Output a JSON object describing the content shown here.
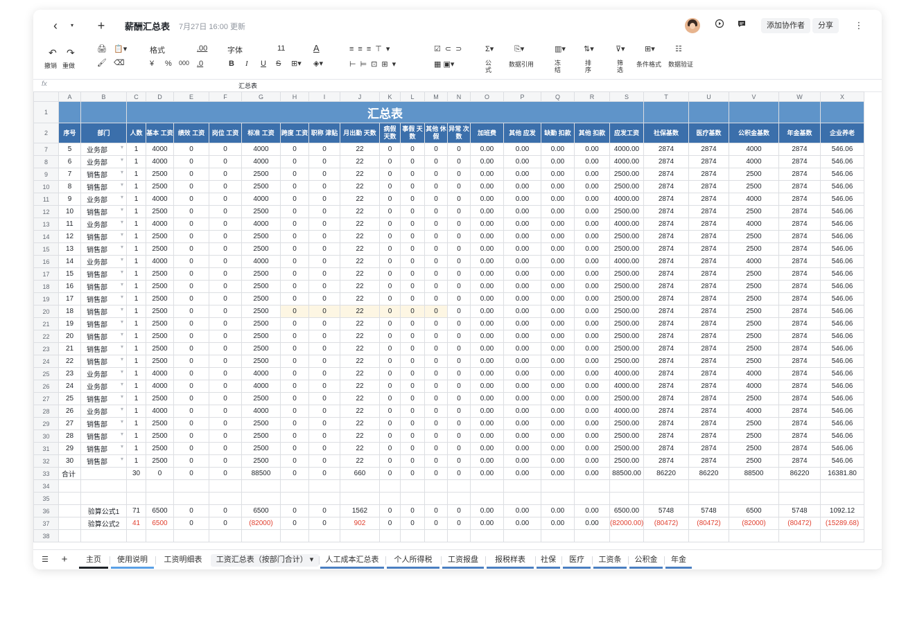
{
  "topbar": {
    "back": "‹",
    "dropdown": "▾",
    "add": "+",
    "title": "薪酬汇总表",
    "updated": "7月27日 16:00 更新",
    "add_collaborator": "添加协作者",
    "share": "分享",
    "more": "⋮"
  },
  "ribbon": {
    "undo": "撤销",
    "redo": "重做",
    "format": "格式",
    "decimal": ".00",
    "font": "字体",
    "font_size": "11",
    "yen": "¥",
    "percent": "%",
    "thousands": "000",
    "decimal2": ".0",
    "bold": "B",
    "italic": "I",
    "underline": "U",
    "strike": "S",
    "formula": "公式",
    "data_ref": "数据引用",
    "freeze": "冻结",
    "sort": "排序",
    "filter": "筛选",
    "cond_format": "条件格式",
    "data_validation": "数据验证"
  },
  "formula_bar": {
    "fx": "fx",
    "value": "汇总表"
  },
  "sheet": {
    "col_letters": [
      "A",
      "B",
      "C",
      "D",
      "E",
      "F",
      "G",
      "H",
      "I",
      "J",
      "K",
      "L",
      "M",
      "N",
      "O",
      "P",
      "Q",
      "R",
      "S",
      "T",
      "U",
      "V",
      "W",
      "X"
    ],
    "title": "汇总表",
    "headers": [
      "序号",
      "部门",
      "人数",
      "基本 工资",
      "绩效 工资",
      "岗位 工资",
      "标准 工资",
      "跨度 工资",
      "职称 津贴",
      "月出勤 天数",
      "病假 天数",
      "事假 天数",
      "其他 休假",
      "异常 次数",
      "加班费",
      "其他 应发",
      "缺勤 扣款",
      "其他 扣款",
      "应发工资",
      "社保基数",
      "医疗基数",
      "公积金基数",
      "年金基数",
      "企业养老"
    ],
    "rows": [
      {
        "r": "7",
        "n": "5",
        "d": "业务部",
        "p": "1",
        "w": "4000",
        "rt": "4000.00",
        "b": "2874",
        "f": "4000",
        "pen": "546.06"
      },
      {
        "r": "8",
        "n": "6",
        "d": "业务部",
        "p": "1",
        "w": "4000",
        "rt": "4000.00",
        "b": "2874",
        "f": "4000",
        "pen": "546.06"
      },
      {
        "r": "9",
        "n": "7",
        "d": "销售部",
        "p": "1",
        "w": "2500",
        "rt": "2500.00",
        "b": "2874",
        "f": "2500",
        "pen": "546.06"
      },
      {
        "r": "10",
        "n": "8",
        "d": "销售部",
        "p": "1",
        "w": "2500",
        "rt": "2500.00",
        "b": "2874",
        "f": "2500",
        "pen": "546.06"
      },
      {
        "r": "11",
        "n": "9",
        "d": "业务部",
        "p": "1",
        "w": "4000",
        "rt": "4000.00",
        "b": "2874",
        "f": "4000",
        "pen": "546.06"
      },
      {
        "r": "12",
        "n": "10",
        "d": "销售部",
        "p": "1",
        "w": "2500",
        "rt": "2500.00",
        "b": "2874",
        "f": "2500",
        "pen": "546.06"
      },
      {
        "r": "13",
        "n": "11",
        "d": "业务部",
        "p": "1",
        "w": "4000",
        "rt": "4000.00",
        "b": "2874",
        "f": "4000",
        "pen": "546.06"
      },
      {
        "r": "14",
        "n": "12",
        "d": "销售部",
        "p": "1",
        "w": "2500",
        "rt": "2500.00",
        "b": "2874",
        "f": "2500",
        "pen": "546.06"
      },
      {
        "r": "15",
        "n": "13",
        "d": "销售部",
        "p": "1",
        "w": "2500",
        "rt": "2500.00",
        "b": "2874",
        "f": "2500",
        "pen": "546.06"
      },
      {
        "r": "16",
        "n": "14",
        "d": "业务部",
        "p": "1",
        "w": "4000",
        "rt": "4000.00",
        "b": "2874",
        "f": "4000",
        "pen": "546.06"
      },
      {
        "r": "17",
        "n": "15",
        "d": "销售部",
        "p": "1",
        "w": "2500",
        "rt": "2500.00",
        "b": "2874",
        "f": "2500",
        "pen": "546.06"
      },
      {
        "r": "18",
        "n": "16",
        "d": "销售部",
        "p": "1",
        "w": "2500",
        "rt": "2500.00",
        "b": "2874",
        "f": "2500",
        "pen": "546.06"
      },
      {
        "r": "19",
        "n": "17",
        "d": "销售部",
        "p": "1",
        "w": "2500",
        "rt": "2500.00",
        "b": "2874",
        "f": "2500",
        "pen": "546.06"
      },
      {
        "r": "20",
        "n": "18",
        "d": "销售部",
        "p": "1",
        "w": "2500",
        "rt": "2500.00",
        "b": "2874",
        "f": "2500",
        "pen": "546.06"
      },
      {
        "r": "21",
        "n": "19",
        "d": "销售部",
        "p": "1",
        "w": "2500",
        "rt": "2500.00",
        "b": "2874",
        "f": "2500",
        "pen": "546.06"
      },
      {
        "r": "22",
        "n": "20",
        "d": "销售部",
        "p": "1",
        "w": "2500",
        "rt": "2500.00",
        "b": "2874",
        "f": "2500",
        "pen": "546.06"
      },
      {
        "r": "23",
        "n": "21",
        "d": "销售部",
        "p": "1",
        "w": "2500",
        "rt": "2500.00",
        "b": "2874",
        "f": "2500",
        "pen": "546.06"
      },
      {
        "r": "24",
        "n": "22",
        "d": "销售部",
        "p": "1",
        "w": "2500",
        "rt": "2500.00",
        "b": "2874",
        "f": "2500",
        "pen": "546.06"
      },
      {
        "r": "25",
        "n": "23",
        "d": "业务部",
        "p": "1",
        "w": "4000",
        "rt": "4000.00",
        "b": "2874",
        "f": "4000",
        "pen": "546.06"
      },
      {
        "r": "26",
        "n": "24",
        "d": "业务部",
        "p": "1",
        "w": "4000",
        "rt": "4000.00",
        "b": "2874",
        "f": "4000",
        "pen": "546.06"
      },
      {
        "r": "27",
        "n": "25",
        "d": "销售部",
        "p": "1",
        "w": "2500",
        "rt": "2500.00",
        "b": "2874",
        "f": "2500",
        "pen": "546.06"
      },
      {
        "r": "28",
        "n": "26",
        "d": "业务部",
        "p": "1",
        "w": "4000",
        "rt": "4000.00",
        "b": "2874",
        "f": "4000",
        "pen": "546.06"
      },
      {
        "r": "29",
        "n": "27",
        "d": "销售部",
        "p": "1",
        "w": "2500",
        "rt": "2500.00",
        "b": "2874",
        "f": "2500",
        "pen": "546.06"
      },
      {
        "r": "30",
        "n": "28",
        "d": "销售部",
        "p": "1",
        "w": "2500",
        "rt": "2500.00",
        "b": "2874",
        "f": "2500",
        "pen": "546.06"
      },
      {
        "r": "31",
        "n": "29",
        "d": "销售部",
        "p": "1",
        "w": "2500",
        "rt": "2500.00",
        "b": "2874",
        "f": "2500",
        "pen": "546.06"
      },
      {
        "r": "32",
        "n": "30",
        "d": "销售部",
        "p": "1",
        "w": "2500",
        "rt": "2500.00",
        "b": "2874",
        "f": "2500",
        "pen": "546.06"
      }
    ],
    "zero": "0",
    "money_zero": "0.00",
    "att": "22",
    "total": {
      "r": "33",
      "label": "合计",
      "p": "30",
      "w": "0",
      "e": "0",
      "f": "0",
      "g": "88500",
      "h": "0",
      "i": "0",
      "j": "660",
      "k": "0",
      "l": "0",
      "m": "0",
      "n": "0",
      "o": "0.00",
      "pp": "0.00",
      "q": "0.00",
      "rr": "0.00",
      "s": "88500.00",
      "t": "86220",
      "u": "86220",
      "v": "88500",
      "ww": "86220",
      "x": "16381.80"
    },
    "blank_rows": [
      "34",
      "35",
      "38"
    ],
    "check1": {
      "r": "36",
      "label": "验算公式1",
      "p": "71",
      "w": "6500",
      "e": "0",
      "f": "0",
      "g": "6500",
      "h": "0",
      "i": "0",
      "j": "1562",
      "k": "0",
      "l": "0",
      "m": "0",
      "n": "0",
      "o": "0.00",
      "pp": "0.00",
      "q": "0.00",
      "rr": "0.00",
      "s": "6500.00",
      "t": "5748",
      "u": "5748",
      "v": "6500",
      "ww": "5748",
      "x": "1092.12"
    },
    "check2": {
      "r": "37",
      "label": "验算公式2",
      "p": "41",
      "w": "6500",
      "e": "0",
      "f": "0",
      "g": "(82000)",
      "h": "0",
      "i": "0",
      "j": "902",
      "k": "0",
      "l": "0",
      "m": "0",
      "n": "0",
      "o": "0.00",
      "pp": "0.00",
      "q": "0.00",
      "rr": "0.00",
      "s": "(82000.00)",
      "t": "(80472)",
      "u": "(80472)",
      "v": "(82000)",
      "ww": "(80472)",
      "x": "(15289.68)"
    },
    "title_row": "1",
    "header_row": "2"
  },
  "tabs": [
    {
      "label": "主页",
      "color": "#1f2329"
    },
    {
      "label": "使用说明",
      "color": "#5aa0e6"
    },
    {
      "label": "工资明细表",
      "color": ""
    },
    {
      "label": "工资汇总表（按部门合计）",
      "color": "",
      "active": true
    },
    {
      "label": "人工成本汇总表",
      "color": "#4a7fc1"
    },
    {
      "label": "个人所得税",
      "color": "#4a7fc1"
    },
    {
      "label": "工资报盘",
      "color": "#4a7fc1"
    },
    {
      "label": "报税样表",
      "color": "#4a7fc1"
    },
    {
      "label": "社保",
      "color": "#4a7fc1"
    },
    {
      "label": "医疗",
      "color": "#4a7fc1"
    },
    {
      "label": "工资条",
      "color": "#4a7fc1"
    },
    {
      "label": "公积金",
      "color": "#4a7fc1"
    },
    {
      "label": "年金",
      "color": "#4a7fc1"
    }
  ],
  "colors": {
    "title_band": "#5f94c9",
    "header_band": "#3b6fab",
    "negative": "#e03e2d"
  }
}
